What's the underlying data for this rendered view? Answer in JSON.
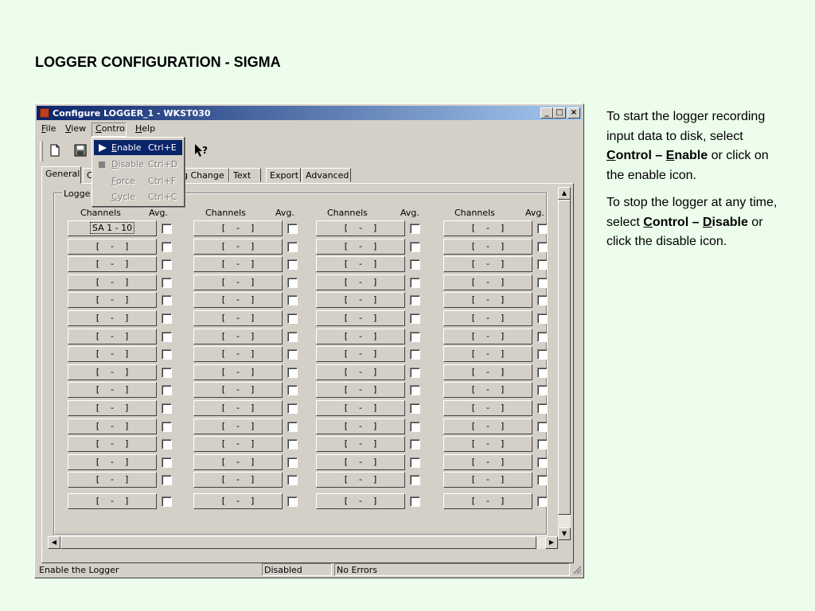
{
  "slide": {
    "title": "LOGGER CONFIGURATION - SIGMA",
    "notes": {
      "p1_a": "To start the logger recording input data to disk, select ",
      "p1_b": "C",
      "p1_c": "ontrol – ",
      "p1_d": "E",
      "p1_e": "nable",
      "p1_f": " or click on the enable icon.",
      "p2_a": "To stop the logger at any time, select ",
      "p2_b": "C",
      "p2_c": "ontrol – ",
      "p2_d": "D",
      "p2_e": "isable",
      "p2_f": " or click the disable icon."
    }
  },
  "window": {
    "title": "Configure LOGGER_1 - WKST030",
    "buttons": {
      "minimize": "_",
      "maximize": "□",
      "close": "×"
    }
  },
  "menubar": [
    {
      "label": "File",
      "key": "F",
      "rest": "ile"
    },
    {
      "label": "View",
      "key": "V",
      "rest": "iew"
    },
    {
      "label": "Control",
      "key": "C",
      "rest": "ontrol"
    },
    {
      "label": "Help",
      "key": "H",
      "rest": "elp"
    }
  ],
  "control_menu": [
    {
      "key": "E",
      "rest": "nable",
      "shortcut": "Ctrl+E",
      "enabled": true,
      "selected": true
    },
    {
      "key": "D",
      "rest": "isable",
      "shortcut": "Ctrl+D",
      "enabled": false,
      "selected": false
    },
    {
      "key": "F",
      "rest": "orce",
      "shortcut": "Ctrl+F",
      "enabled": false,
      "selected": false
    },
    {
      "key": "C",
      "rest": "ycle",
      "shortcut": "Ctrl+C",
      "enabled": false,
      "selected": false
    }
  ],
  "tabs": {
    "general": "General",
    "hidden_partial": "C",
    "change": "g Change",
    "text": "Text",
    "export": "Export",
    "advanced": "Advanced"
  },
  "group": {
    "label": "Logge"
  },
  "grid": {
    "col_header_channels": "Channels",
    "col_header_avg": "Avg.",
    "first_cell": "SA 1 - 10",
    "empty_cell": "[    -    ]",
    "rows": 16,
    "cols": 4
  },
  "statusbar": {
    "message": "Enable the Logger",
    "state": "Disabled",
    "errors": "No Errors"
  },
  "icons": [
    "app-icon",
    "new-document-icon",
    "save-icon",
    "context-help-icon",
    "play-icon",
    "stop-icon"
  ]
}
